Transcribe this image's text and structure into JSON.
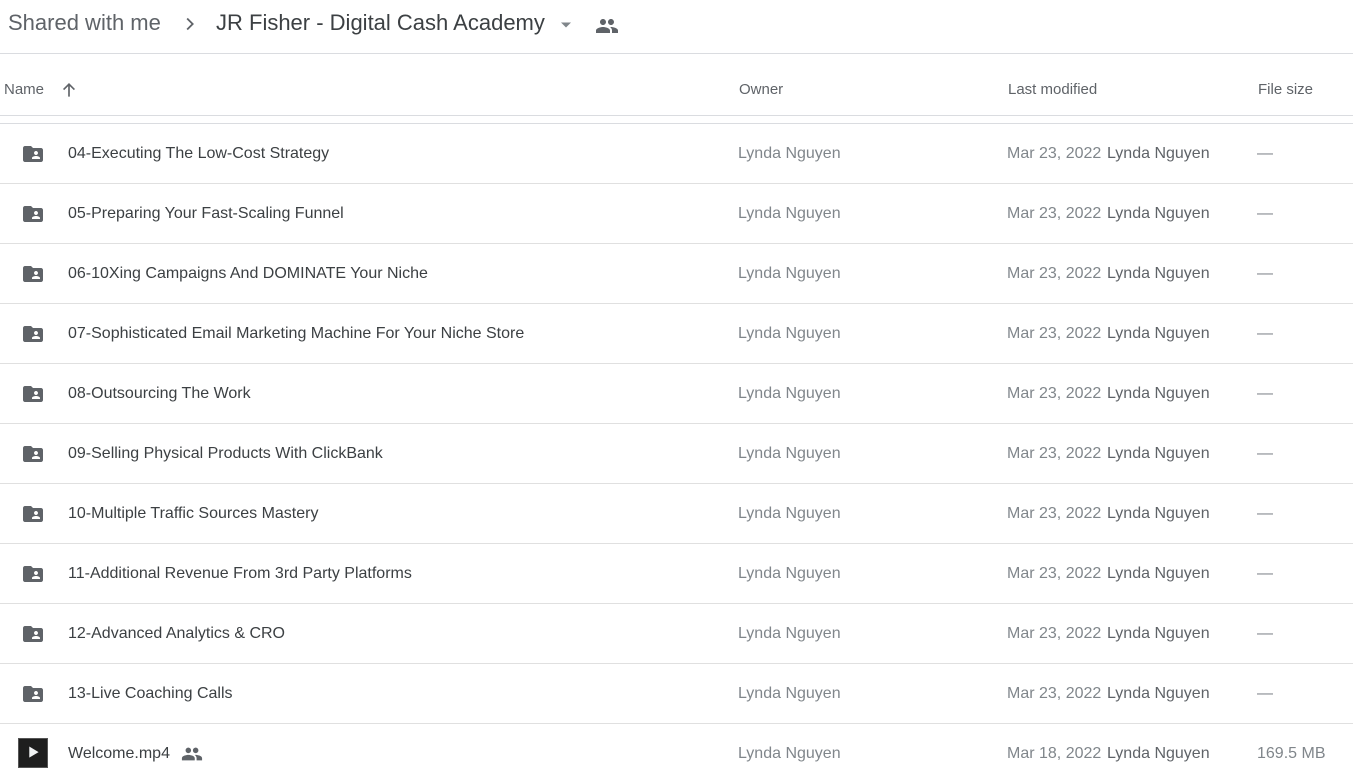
{
  "breadcrumb": {
    "root": "Shared with me",
    "current": "JR Fisher - Digital Cash Academy"
  },
  "icons": {
    "separator": "chevron-right-icon",
    "caret": "caret-down-icon",
    "shared": "people-icon",
    "sort": "arrow-up-icon",
    "folder": "shared-folder-icon",
    "video": "video-thumbnail"
  },
  "colors": {
    "text_primary": "#3c4043",
    "text_secondary": "#5f6368",
    "text_muted": "#80868b",
    "divider": "#dadce0"
  },
  "columns": {
    "name": "Name",
    "owner": "Owner",
    "modified": "Last modified",
    "size": "File size"
  },
  "sort": {
    "column": "Name",
    "direction": "ascending"
  },
  "rows": [
    {
      "type": "folder",
      "name": "04-Executing The Low-Cost Strategy",
      "owner": "Lynda Nguyen",
      "date": "Mar 23, 2022",
      "modified_by": "Lynda Nguyen",
      "size": "—"
    },
    {
      "type": "folder",
      "name": "05-Preparing Your Fast-Scaling Funnel",
      "owner": "Lynda Nguyen",
      "date": "Mar 23, 2022",
      "modified_by": "Lynda Nguyen",
      "size": "—"
    },
    {
      "type": "folder",
      "name": "06-10Xing Campaigns And DOMINATE Your Niche",
      "owner": "Lynda Nguyen",
      "date": "Mar 23, 2022",
      "modified_by": "Lynda Nguyen",
      "size": "—"
    },
    {
      "type": "folder",
      "name": "07-Sophisticated Email Marketing Machine For Your Niche Store",
      "owner": "Lynda Nguyen",
      "date": "Mar 23, 2022",
      "modified_by": "Lynda Nguyen",
      "size": "—"
    },
    {
      "type": "folder",
      "name": "08-Outsourcing The Work",
      "owner": "Lynda Nguyen",
      "date": "Mar 23, 2022",
      "modified_by": "Lynda Nguyen",
      "size": "—"
    },
    {
      "type": "folder",
      "name": "09-Selling Physical Products With ClickBank",
      "owner": "Lynda Nguyen",
      "date": "Mar 23, 2022",
      "modified_by": "Lynda Nguyen",
      "size": "—"
    },
    {
      "type": "folder",
      "name": "10-Multiple Traffic Sources Mastery",
      "owner": "Lynda Nguyen",
      "date": "Mar 23, 2022",
      "modified_by": "Lynda Nguyen",
      "size": "—"
    },
    {
      "type": "folder",
      "name": "11-Additional Revenue From 3rd Party Platforms",
      "owner": "Lynda Nguyen",
      "date": "Mar 23, 2022",
      "modified_by": "Lynda Nguyen",
      "size": "—"
    },
    {
      "type": "folder",
      "name": "12-Advanced Analytics & CRO",
      "owner": "Lynda Nguyen",
      "date": "Mar 23, 2022",
      "modified_by": "Lynda Nguyen",
      "size": "—"
    },
    {
      "type": "folder",
      "name": "13-Live Coaching Calls",
      "owner": "Lynda Nguyen",
      "date": "Mar 23, 2022",
      "modified_by": "Lynda Nguyen",
      "size": "—"
    },
    {
      "type": "video",
      "name": "Welcome.mp4",
      "shared": true,
      "owner": "Lynda Nguyen",
      "date": "Mar 18, 2022",
      "modified_by": "Lynda Nguyen",
      "size": "169.5 MB"
    }
  ]
}
